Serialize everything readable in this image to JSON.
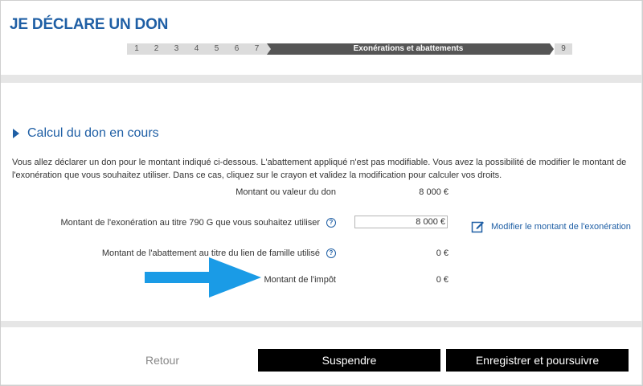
{
  "header": {
    "title": "JE DÉCLARE UN DON"
  },
  "stepper": {
    "steps": [
      "1",
      "2",
      "3",
      "4",
      "5",
      "6",
      "7"
    ],
    "active_label": "Exonérations et abattements",
    "last_step": "9"
  },
  "section": {
    "title": "Calcul du don en cours",
    "intro": "Vous allez déclarer un don pour le montant indiqué ci-dessous. L'abattement appliqué n'est pas modifiable. Vous avez la possibilité de modifier le montant de l'exonération que vous souhaitez utiliser. Dans ce cas, cliquez sur le crayon et validez la modification pour calculer vos droits."
  },
  "rows": {
    "don_label": "Montant ou valeur du don",
    "don_value": "8 000  €",
    "exoneration_label": "Montant de l'exonération au titre 790 G que vous souhaitez utiliser",
    "exoneration_value": "8 000 €",
    "abattement_label": "Montant de l'abattement au titre du lien de famille utilisé",
    "abattement_value": "0 €",
    "impot_label": "Montant de l'impôt",
    "impot_value": "0 €",
    "help_glyph": "?"
  },
  "actions": {
    "modify_link": "Modifier le montant de l'exonération",
    "retour": "Retour",
    "suspendre": "Suspendre",
    "enregistrer": "Enregistrer et poursuivre"
  },
  "colors": {
    "accent": "#1f5fa5",
    "arrow": "#1a9be6",
    "button": "#000000"
  }
}
